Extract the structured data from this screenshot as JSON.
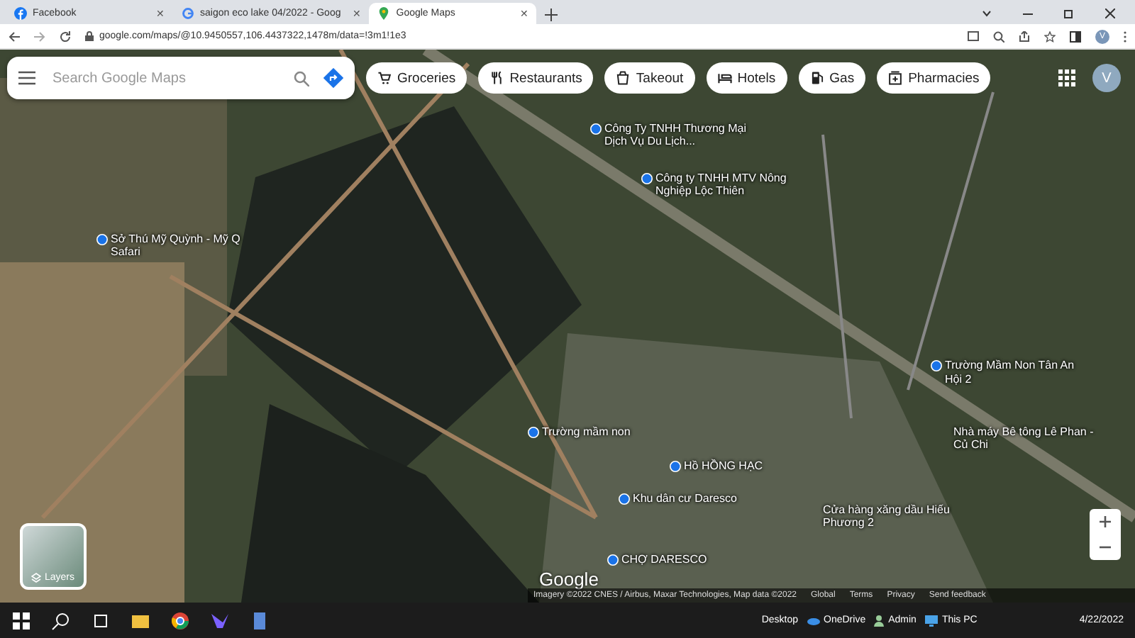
{
  "browser": {
    "tabs": [
      {
        "title": "Facebook",
        "close": "✕",
        "selected": false
      },
      {
        "title": "saigon eco lake 04/2022 - Goog",
        "close": "✕",
        "selected": false
      },
      {
        "title": "Google Maps",
        "close": "✕",
        "selected": true
      }
    ],
    "url": "google.com/maps/@10.9450557,106.4437322,1478m/data=!3m1!1e3",
    "profile": "V"
  },
  "maps": {
    "search": {
      "placeholder": "Search Google Maps"
    },
    "chips": [
      {
        "label": "Groceries"
      },
      {
        "label": "Restaurants"
      },
      {
        "label": "Takeout"
      },
      {
        "label": "Hotels"
      },
      {
        "label": "Gas"
      },
      {
        "label": "Pharmacies"
      }
    ],
    "account": "V",
    "labels": [
      {
        "text": "Công Ty TNHH Thương Mại Dịch Vụ Du Lịch...",
        "kind": "poi"
      },
      {
        "text": "Công ty TNHH MTV Nông Nghiệp Lộc Thiên",
        "kind": "poi"
      },
      {
        "text": "Sở Thú Mỹ Quỳnh - Mỹ Q Safari",
        "kind": "poi"
      },
      {
        "text": "Trường Mầm Non Tân An Hội 2",
        "kind": "poi"
      },
      {
        "text": "Trường mầm non",
        "kind": "poi"
      },
      {
        "text": "Nhà máy Bê tông Lê Phan - Củ Chi",
        "kind": "place"
      },
      {
        "text": "Hồ HỒNG HẠC",
        "kind": "poi"
      },
      {
        "text": "Khu dân cư Daresco",
        "kind": "poi"
      },
      {
        "text": "Cửa hàng xăng dầu Hiếu Phương 2",
        "kind": "place"
      },
      {
        "text": "CHỢ DARESCO",
        "kind": "poi"
      }
    ],
    "layers": "Layers",
    "logo": "Google",
    "attribution": [
      "Imagery ©2022 CNES / Airbus, Maxar Technologies, Map data ©2022",
      "Global",
      "Terms",
      "Privacy",
      "Send feedback"
    ]
  },
  "taskbar": {
    "desktop": "Desktop",
    "onedrive": "OneDrive",
    "admin": "Admin",
    "thispc": "This PC",
    "date": "4/22/2022"
  }
}
